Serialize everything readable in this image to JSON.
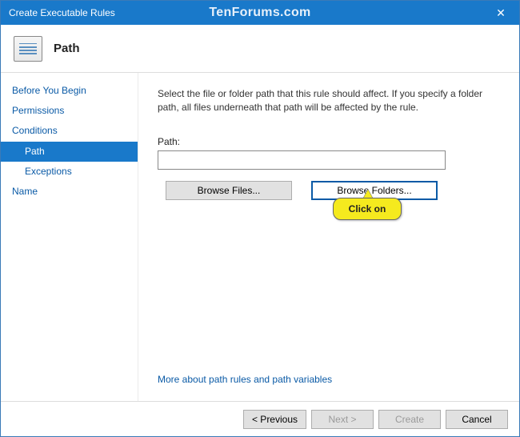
{
  "window": {
    "title": "Create Executable Rules",
    "watermark": "TenForums.com"
  },
  "header": {
    "title": "Path"
  },
  "sidebar": {
    "items": [
      {
        "label": "Before You Begin",
        "sub": false,
        "selected": false
      },
      {
        "label": "Permissions",
        "sub": false,
        "selected": false
      },
      {
        "label": "Conditions",
        "sub": false,
        "selected": false
      },
      {
        "label": "Path",
        "sub": true,
        "selected": true
      },
      {
        "label": "Exceptions",
        "sub": true,
        "selected": false
      },
      {
        "label": "Name",
        "sub": false,
        "selected": false
      }
    ]
  },
  "content": {
    "instruction": "Select the file or folder path that this rule should affect. If you specify a folder path, all files underneath that path will be affected by the rule.",
    "path_label": "Path:",
    "path_value": "",
    "browse_files": "Browse Files...",
    "browse_folders": "Browse Folders...",
    "callout": "Click on",
    "more_link": "More about path rules and path variables"
  },
  "footer": {
    "previous": "< Previous",
    "next": "Next >",
    "create": "Create",
    "cancel": "Cancel"
  }
}
